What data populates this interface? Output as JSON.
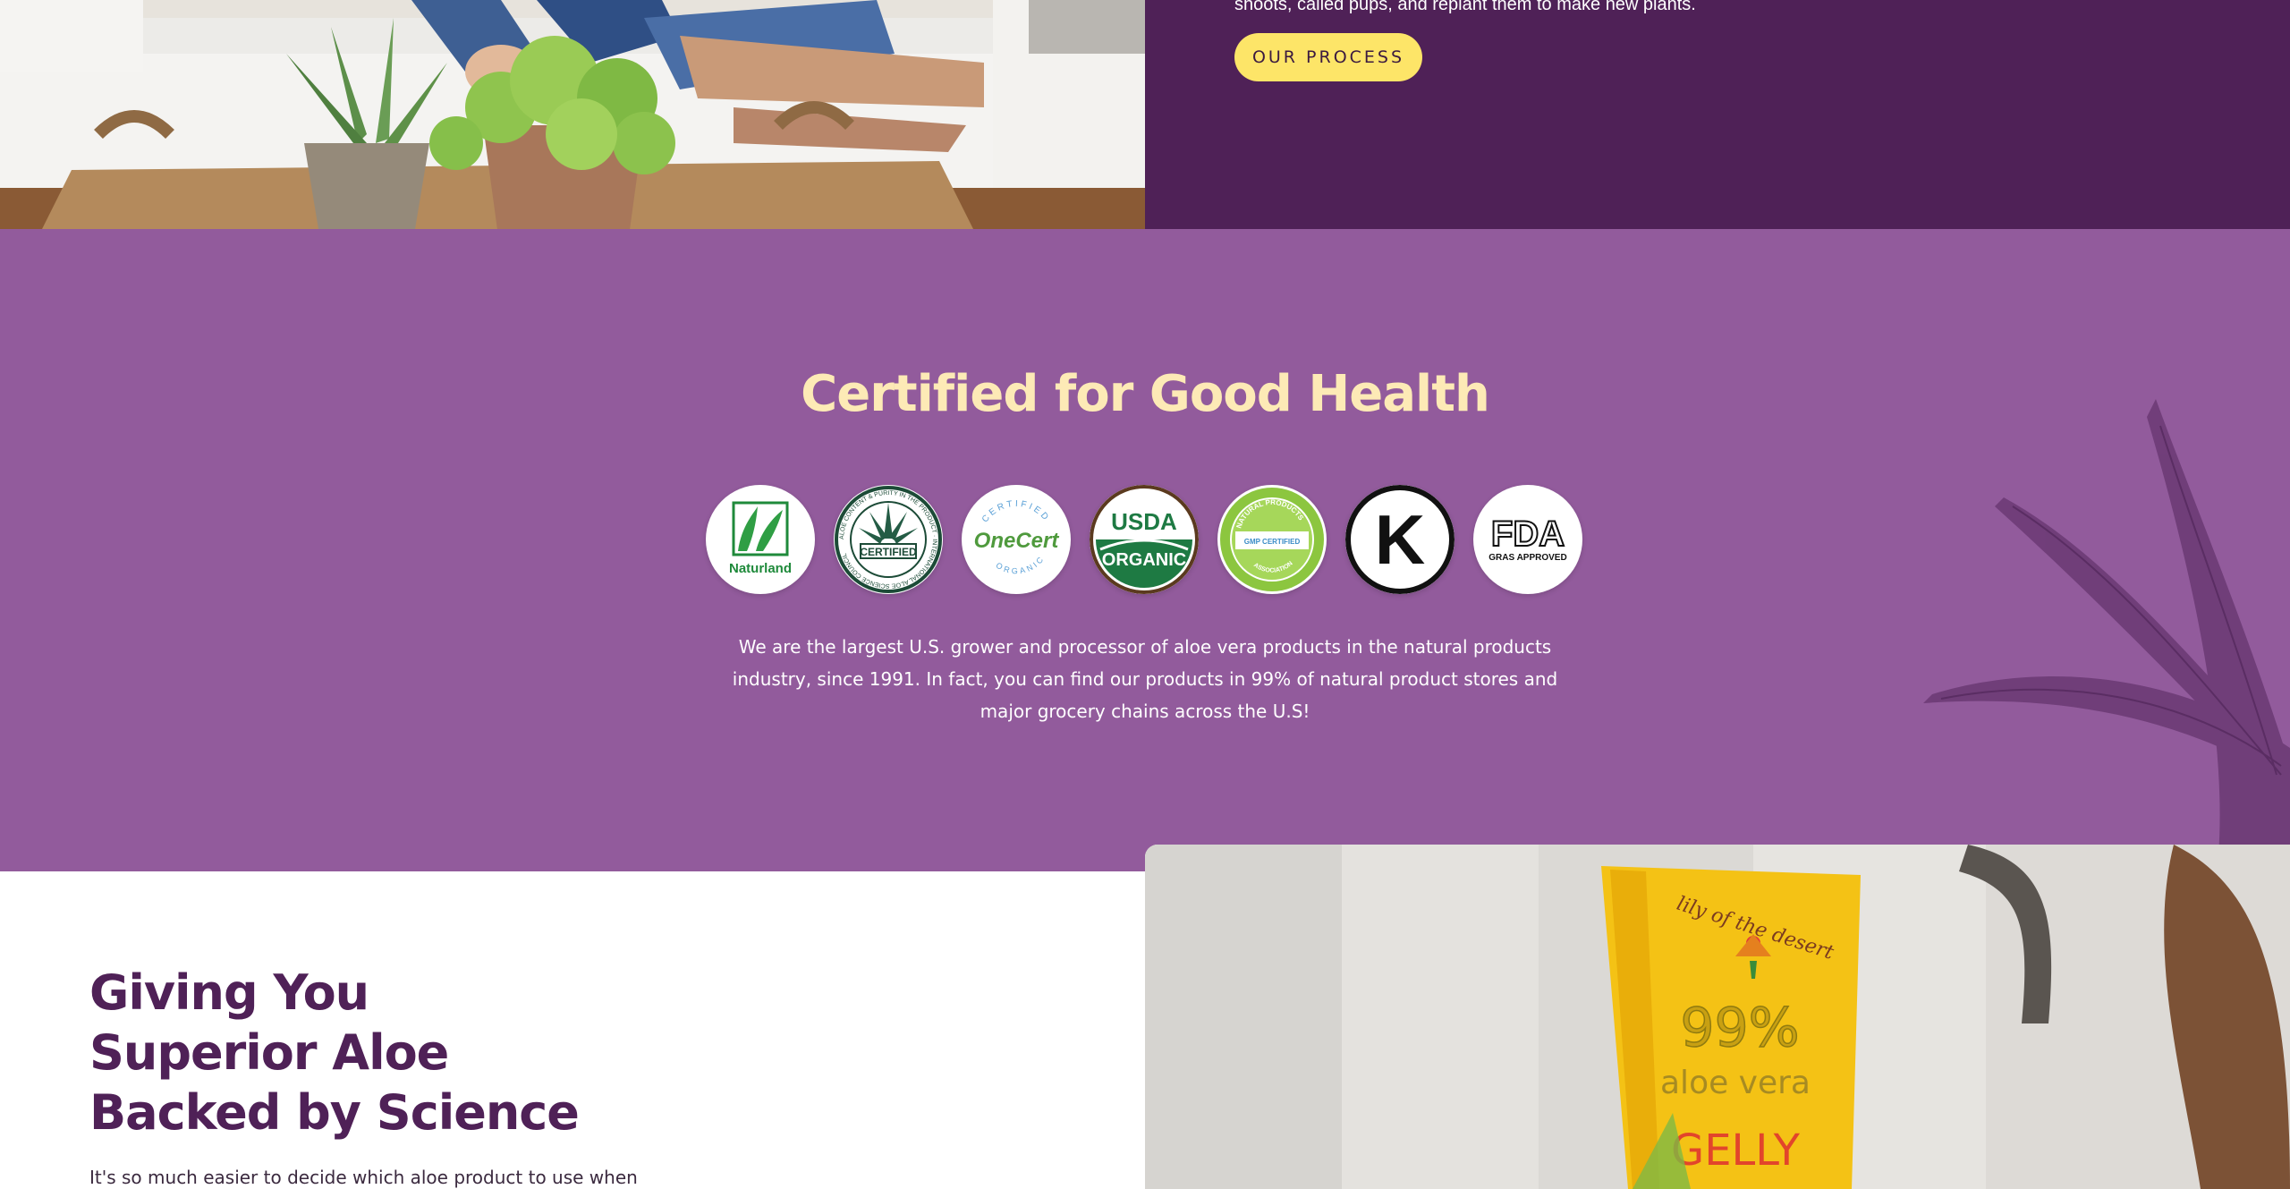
{
  "hero": {
    "process_text": "shoots, called pups, and replant them to make new plants.",
    "process_button": "OUR PROCESS"
  },
  "certified": {
    "title": "Certified for Good Health",
    "badges": [
      {
        "name": "naturland-icon",
        "label": "Naturland"
      },
      {
        "name": "iasc-certified-icon",
        "label": "CERTIFIED",
        "ring_text": "ALOE CONTENT & PURITY IN THE PRODUCT · INTERNATIONAL ALOE SCIENCE COUNCIL"
      },
      {
        "name": "onecert-icon",
        "label": "OneCert",
        "top": "CERTIFIED",
        "bottom": "ORGANIC"
      },
      {
        "name": "usda-organic-icon",
        "top": "USDA",
        "bottom": "ORGANIC"
      },
      {
        "name": "gmp-certified-icon",
        "top": "NATURAL PRODUCTS",
        "middle": "GMP CERTIFIED",
        "bottom": "ASSOCIATION"
      },
      {
        "name": "kosher-k-icon",
        "label": "K"
      },
      {
        "name": "fda-gras-icon",
        "top": "FDA",
        "bottom": "GRAS APPROVED"
      }
    ],
    "description": "We are the largest U.S. grower and processor of aloe vera products in the natural products industry, since 1991. In fact, you can find our products in 99% of natural product stores and major grocery chains across the U.S!"
  },
  "science": {
    "title": "Giving You Superior Aloe Backed by Science",
    "text": "It's so much easier to decide which aloe product to use when"
  },
  "product": {
    "brand": "lily of the desert",
    "percent": "99%",
    "name": "aloe vera",
    "variant": "GELLY"
  },
  "colors": {
    "dark_purple": "#4f2157",
    "band_purple": "#925b9c",
    "title_cream": "#fdeab6",
    "button_yellow": "#fde568"
  }
}
